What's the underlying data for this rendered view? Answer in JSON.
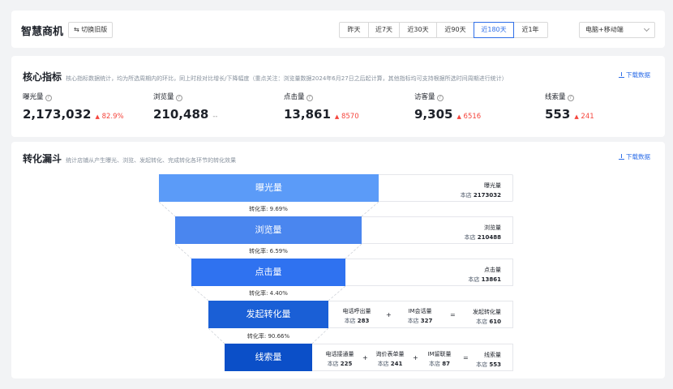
{
  "header": {
    "title": "智慧商机",
    "switch_label": "切换旧版",
    "date_tabs": [
      "昨天",
      "近7天",
      "近30天",
      "近90天",
      "近180天",
      "近1年"
    ],
    "active_tab": "近180天",
    "device": "电脑+移动端"
  },
  "core": {
    "title": "核心指标",
    "desc": "核心指标数据统计，均为所选周期内的环比，同上时段对比增长/下降幅度（重点关注：浏览量数据2024年6月27日之后起计算，其他指标均可支持根据所选时间周期进行统计）",
    "download": "下载数据",
    "metrics": [
      {
        "label": "曝光量",
        "value": "2,173,032",
        "change": "82.9%",
        "trend": "up"
      },
      {
        "label": "浏览量",
        "value": "210,488",
        "change": "--",
        "trend": "none"
      },
      {
        "label": "点击量",
        "value": "13,861",
        "change": "8570",
        "trend": "up"
      },
      {
        "label": "访客量",
        "value": "9,305",
        "change": "6516",
        "trend": "up"
      },
      {
        "label": "线索量",
        "value": "553",
        "change": "241",
        "trend": "up"
      }
    ]
  },
  "funnel": {
    "title": "转化漏斗",
    "desc": "统计店铺从产生曝光、浏览、发起转化、完成转化各环节的转化效果",
    "download": "下载数据",
    "store_label": "本店",
    "stages": [
      {
        "label": "曝光量",
        "name": "曝光量",
        "value": "2173032"
      },
      {
        "label": "浏览量",
        "name": "浏览量",
        "value": "210488"
      },
      {
        "label": "点击量",
        "name": "点击量",
        "value": "13861"
      },
      {
        "label": "发起转化量",
        "name": "发起转化量",
        "value": "610"
      },
      {
        "label": "线索量",
        "name": "线索量",
        "value": "553"
      }
    ],
    "conversions": [
      "转化率: 9.69%",
      "转化率: 6.59%",
      "转化率: 4.40%",
      "转化率: 90.66%"
    ],
    "formula_initiate": [
      {
        "name": "电话呼出量",
        "value": "283"
      },
      {
        "name": "IM会话量",
        "value": "327"
      }
    ],
    "formula_leads": [
      {
        "name": "电话接通量",
        "value": "225"
      },
      {
        "name": "询价表单量",
        "value": "241"
      },
      {
        "name": "IM留联量",
        "value": "87"
      }
    ],
    "op_plus": "+",
    "op_eq": "=",
    "colors": [
      "#5b9bf8",
      "#4a86ef",
      "#2f72f0",
      "#1a5fd6",
      "#0b4fc8"
    ]
  }
}
